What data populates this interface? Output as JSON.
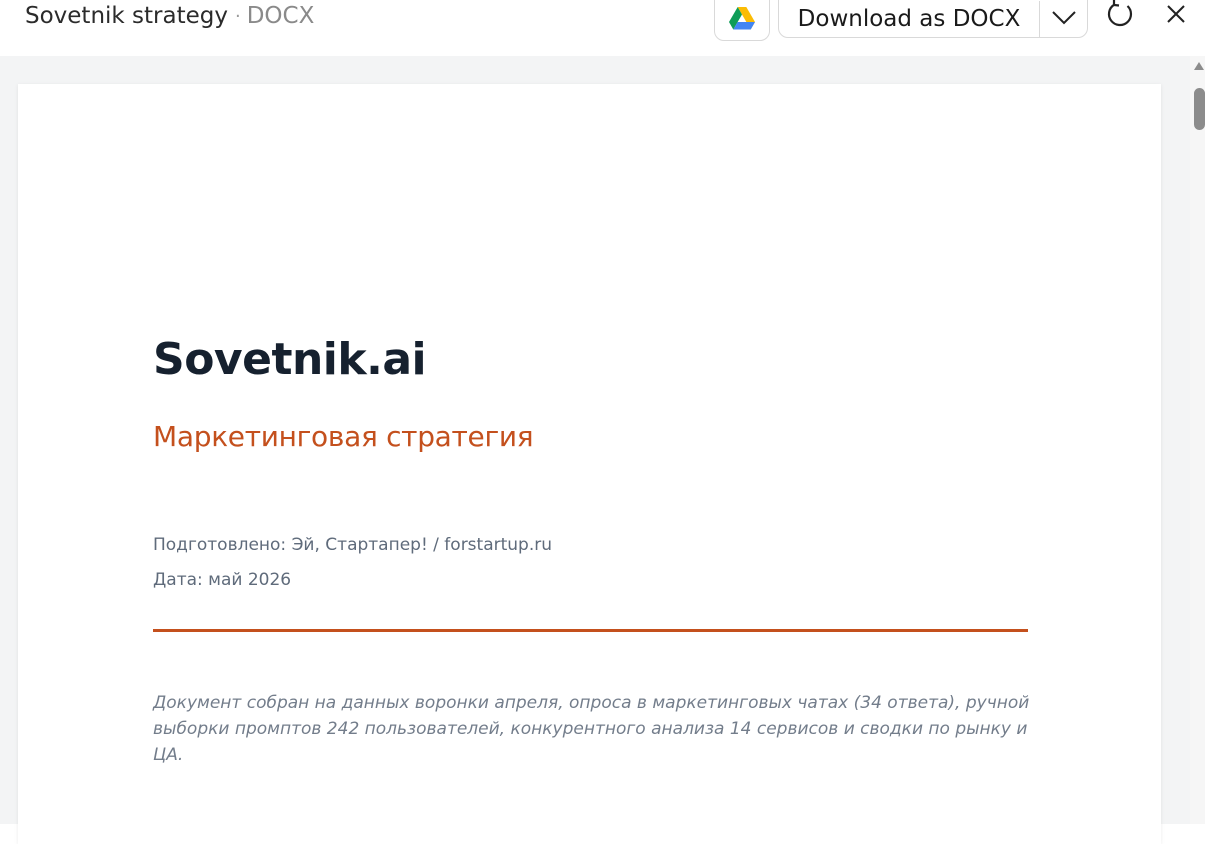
{
  "header": {
    "file_name": "Sovetnik strategy",
    "separator": "·",
    "file_type": "DOCX",
    "download_label": "Download as DOCX",
    "icons": {
      "drive": "google-drive-icon",
      "dropdown": "chevron-down-icon",
      "refresh": "refresh-icon",
      "close": "close-icon"
    }
  },
  "document": {
    "title": "Sovetnik.ai",
    "subtitle": "Маркетинговая стратегия",
    "prepared_by": "Подготовлено: Эй, Стартапер! / forstartup.ru",
    "date": "Дата: май 2026",
    "summary": "Документ собран на данных воронки апреля, опроса в маркетинговых чатах (34 ответа), ручной выборки промптов 242 пользователей, конкурентного анализа 14 сервисов и сводки по рынку и ЦА."
  },
  "colors": {
    "accent": "#c4501d",
    "title": "#16212f",
    "meta_text": "#5f6b7b",
    "viewer_bg": "#f3f4f5"
  }
}
